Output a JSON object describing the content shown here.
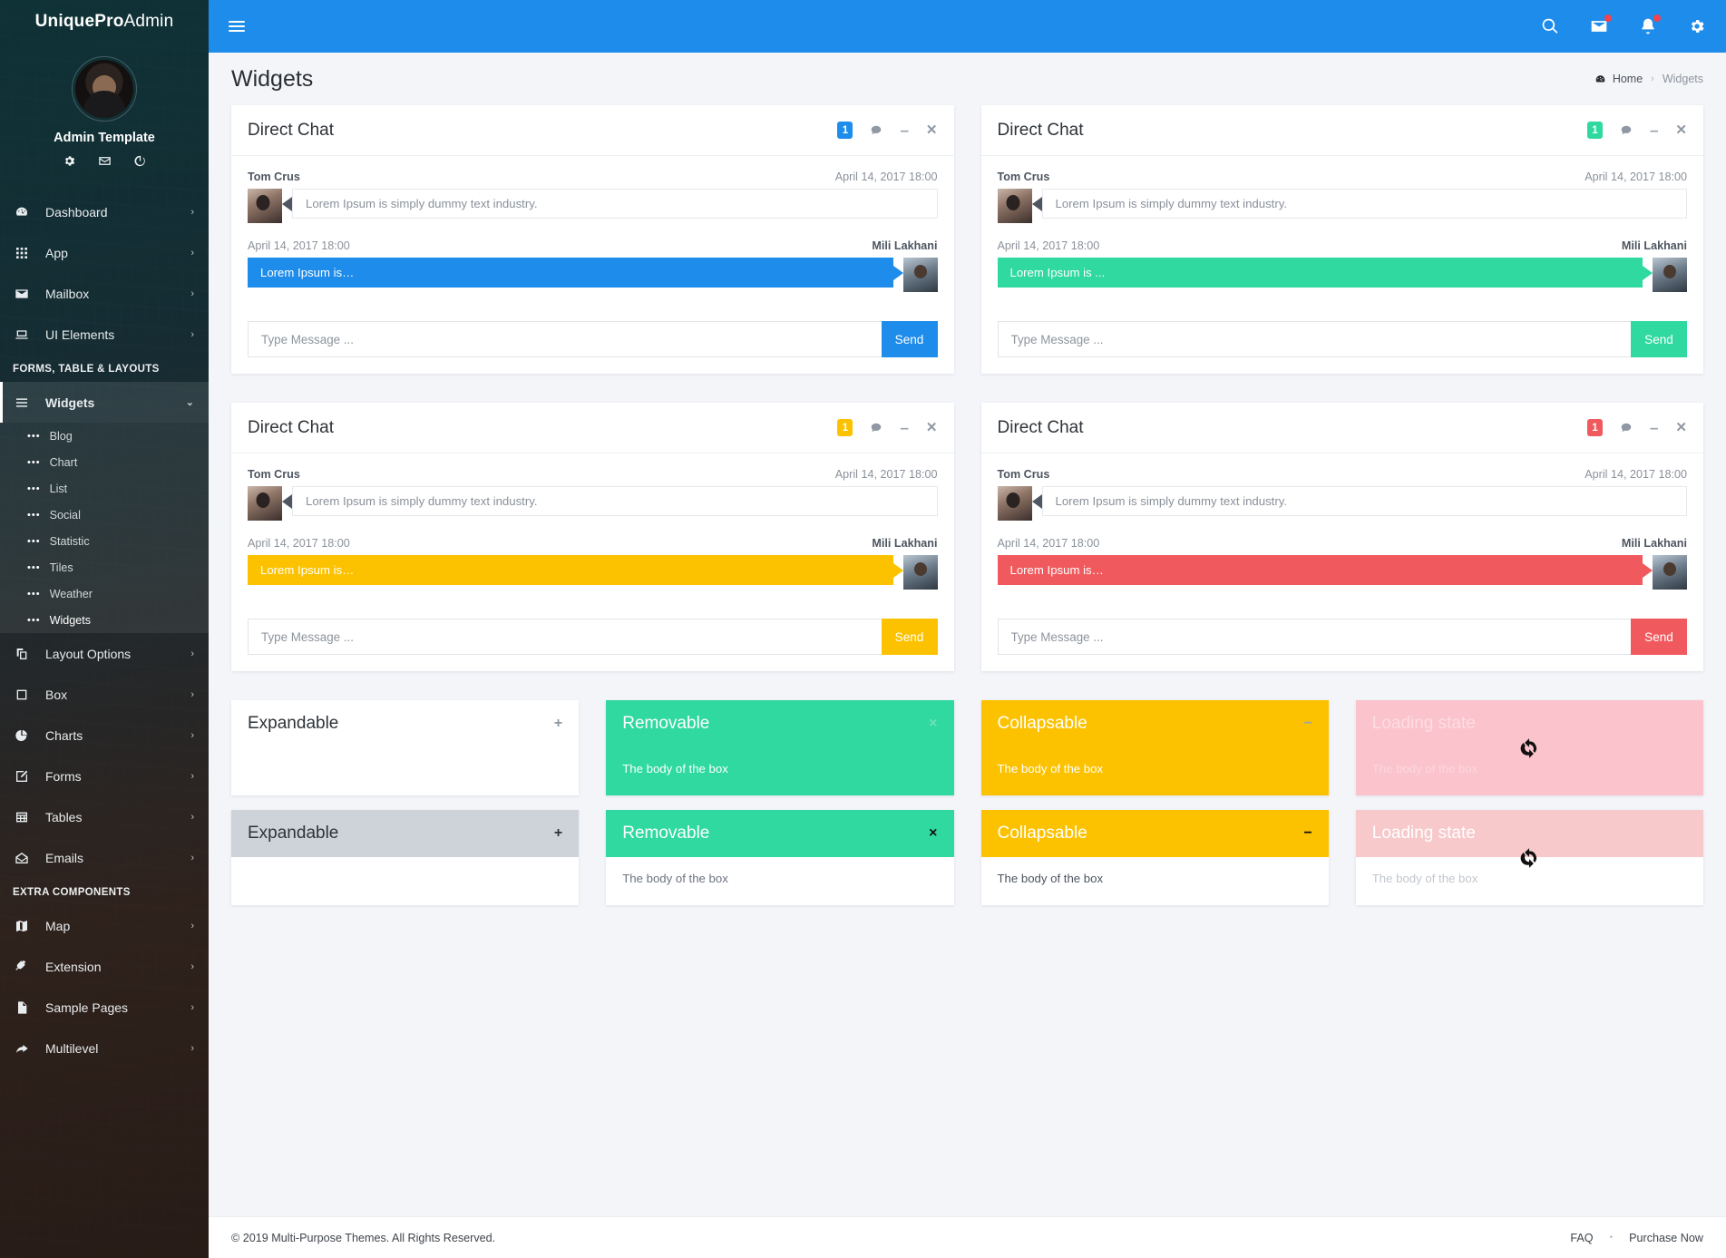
{
  "sidebar": {
    "brand_bold": "UniquePro",
    "brand_light": " Admin",
    "profile_name": "Admin Template",
    "profile_actions": [
      "gear-icon",
      "mail-icon",
      "power-icon"
    ],
    "items": [
      {
        "label": "Dashboard",
        "icon": "dashboard-icon",
        "arrow": "›"
      },
      {
        "label": "App",
        "icon": "grid-icon",
        "arrow": "›"
      },
      {
        "label": "Mailbox",
        "icon": "envelope-icon",
        "arrow": "›"
      },
      {
        "label": "UI Elements",
        "icon": "monitor-icon",
        "arrow": "›"
      }
    ],
    "section_forms": "FORMS, TABLE & LAYOUTS",
    "widgets": {
      "label": "Widgets",
      "icon": "bars-icon",
      "arrow": "⌄"
    },
    "widgets_sub": [
      "Blog",
      "Chart",
      "List",
      "Social",
      "Statistic",
      "Tiles",
      "Weather",
      "Widgets"
    ],
    "items2": [
      {
        "label": "Layout Options",
        "icon": "layers-icon",
        "arrow": "›"
      },
      {
        "label": "Box",
        "icon": "square-icon",
        "arrow": "›"
      },
      {
        "label": "Charts",
        "icon": "pie-icon",
        "arrow": "›"
      },
      {
        "label": "Forms",
        "icon": "edit-icon",
        "arrow": "›"
      },
      {
        "label": "Tables",
        "icon": "table-icon",
        "arrow": "›"
      },
      {
        "label": "Emails",
        "icon": "open-envelope-icon",
        "arrow": "›"
      }
    ],
    "section_extra": "EXTRA COMPONENTS",
    "items3": [
      {
        "label": "Map",
        "icon": "map-icon",
        "arrow": "›"
      },
      {
        "label": "Extension",
        "icon": "plug-icon",
        "arrow": "›"
      },
      {
        "label": "Sample Pages",
        "icon": "file-icon",
        "arrow": "›"
      },
      {
        "label": "Multilevel",
        "icon": "share-arrow-icon",
        "arrow": "›"
      }
    ]
  },
  "topbar": {
    "accent": "#1d8ceb",
    "icons": [
      "search-icon",
      "mail-icon",
      "bell-icon",
      "gear-icon"
    ],
    "badge_color": "#f4434f"
  },
  "page": {
    "title": "Widgets",
    "breadcrumb_home": "Home",
    "breadcrumb_sep": "›",
    "breadcrumb_current": "Widgets"
  },
  "chats": [
    {
      "title": "Direct Chat",
      "badge": "1",
      "color": "#1d8ceb",
      "in_name": "Tom Crus",
      "in_time": "April 14, 2017 18:00",
      "in_text": "Lorem Ipsum is simply dummy text industry.",
      "out_name": "Mili Lakhani",
      "out_time": "April 14, 2017 18:00",
      "out_text": "Lorem Ipsum is…",
      "placeholder": "Type Message ...",
      "send": "Send"
    },
    {
      "title": "Direct Chat",
      "badge": "1",
      "color": "#2fd9a0",
      "in_name": "Tom Crus",
      "in_time": "April 14, 2017 18:00",
      "in_text": "Lorem Ipsum is simply dummy text industry.",
      "out_name": "Mili Lakhani",
      "out_time": "April 14, 2017 18:00",
      "out_text": "Lorem Ipsum is ...",
      "placeholder": "Type Message ...",
      "send": "Send"
    },
    {
      "title": "Direct Chat",
      "badge": "1",
      "color": "#fcc200",
      "in_name": "Tom Crus",
      "in_time": "April 14, 2017 18:00",
      "in_text": "Lorem Ipsum is simply dummy text industry.",
      "out_name": "Mili Lakhani",
      "out_time": "April 14, 2017 18:00",
      "out_text": "Lorem Ipsum is…",
      "placeholder": "Type Message ...",
      "send": "Send"
    },
    {
      "title": "Direct Chat",
      "badge": "1",
      "color": "#f05a5e",
      "in_name": "Tom Crus",
      "in_time": "April 14, 2017 18:00",
      "in_text": "Lorem Ipsum is simply dummy text industry.",
      "out_name": "Mili Lakhani",
      "out_time": "April 14, 2017 18:00",
      "out_text": "Lorem Ipsum is…",
      "placeholder": "Type Message ...",
      "send": "Send"
    }
  ],
  "boxes_row1": [
    {
      "title": "Expandable",
      "action": "+",
      "body": "",
      "head_bg": "#ffffff",
      "head_fg": "#2e3338",
      "body_bg": "#ffffff",
      "body_fg": "#6b7280",
      "action_fg": "#8f98a3",
      "show_body": false,
      "spinner": false
    },
    {
      "title": "Removable",
      "action": "×",
      "body": "The body of the box",
      "head_bg": "#2fd9a0",
      "head_fg": "#ffffff",
      "body_bg": "#2fd9a0",
      "body_fg": "#ffffff",
      "action_fg": "#6fe0bc",
      "show_body": true,
      "spinner": false
    },
    {
      "title": "Collapsable",
      "action": "−",
      "body": "The body of the box",
      "head_bg": "#fcc200",
      "head_fg": "#ffffff",
      "body_bg": "#fcc200",
      "body_fg": "#ffffff",
      "action_fg": "#9aa2ac",
      "show_body": true,
      "spinner": false
    },
    {
      "title": "Loading state",
      "action": "",
      "body": "The body of the box",
      "head_bg": "#fbc3cc",
      "head_fg": "#fddde2",
      "body_bg": "#fbc3cc",
      "body_fg": "#fbd7dd",
      "action_fg": "#fbc3cc",
      "show_body": true,
      "spinner": true
    }
  ],
  "boxes_row2": [
    {
      "title": "Expandable",
      "action": "+",
      "body": "",
      "head_bg": "#ced3da",
      "head_fg": "#2e3338",
      "body_bg": "#ffffff",
      "body_fg": "#6b7280",
      "action_fg": "#2e3338",
      "show_body": false,
      "spinner": false
    },
    {
      "title": "Removable",
      "action": "×",
      "body": "The body of the box",
      "head_bg": "#2fd9a0",
      "head_fg": "#ffffff",
      "body_bg": "#ffffff",
      "body_fg": "#6b7280",
      "action_fg": "#111111",
      "show_body": true,
      "spinner": false
    },
    {
      "title": "Collapsable",
      "action": "−",
      "body": "The body of the box",
      "head_bg": "#fcc200",
      "head_fg": "#ffffff",
      "body_bg": "#ffffff",
      "body_fg": "#4d5560",
      "action_fg": "#111111",
      "show_body": true,
      "spinner": false
    },
    {
      "title": "Loading state",
      "action": "",
      "body": "The body of the box",
      "head_bg": "#f7c9cb",
      "head_fg": "#ffffff",
      "body_bg": "#ffffff",
      "body_fg": "#c2c7cd",
      "action_fg": "#f7c9cb",
      "show_body": true,
      "spinner": true
    }
  ],
  "footer": {
    "copyright": "© 2019 Multi-Purpose Themes. All Rights Reserved.",
    "link_faq": "FAQ",
    "sep": "•",
    "link_purchase": "Purchase Now"
  }
}
